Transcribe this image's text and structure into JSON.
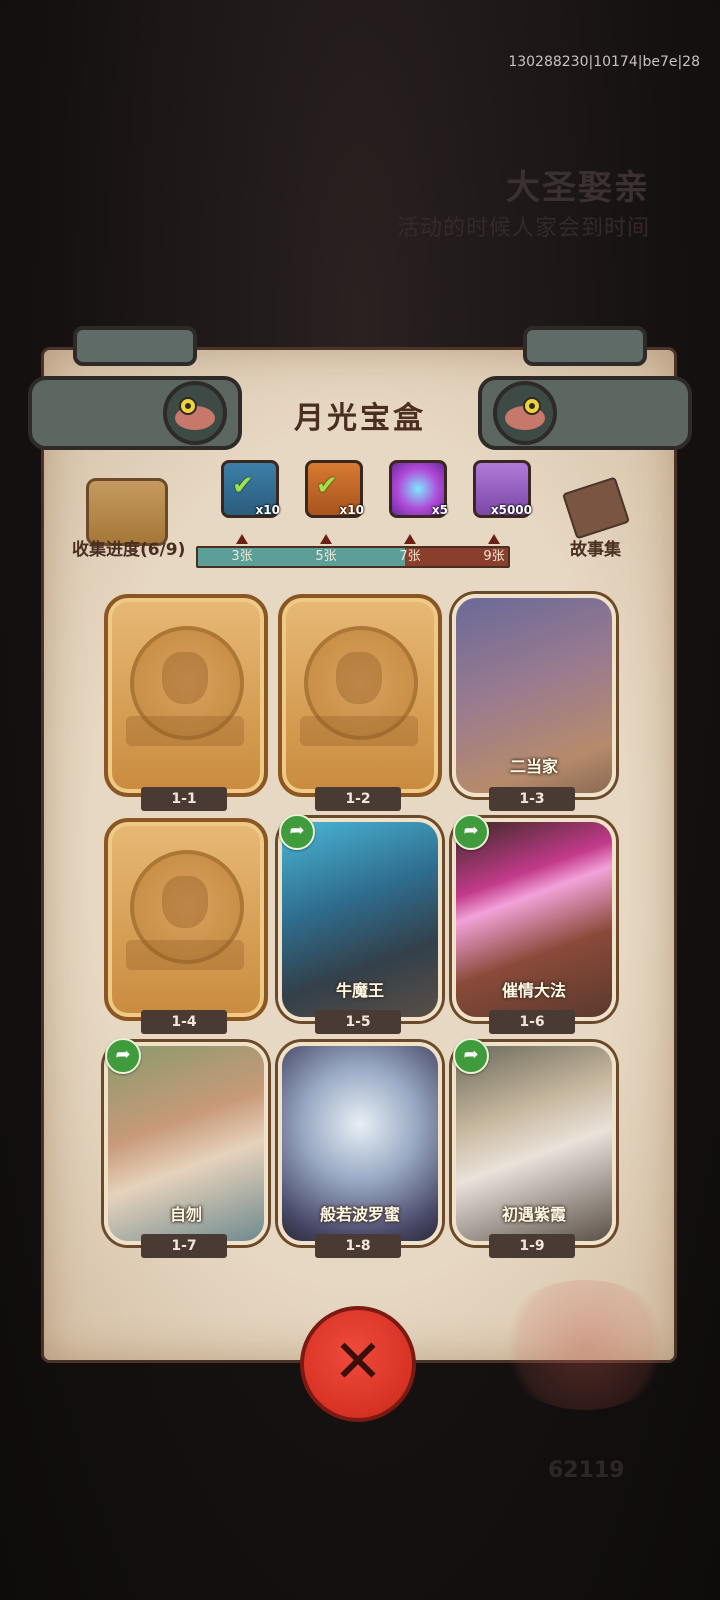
{
  "debug_id": "130288230|10174|be7e|28",
  "background": {
    "title": "大圣娶亲",
    "subtitle": "活动的时候人家会到时间",
    "coins": "62119"
  },
  "panel": {
    "title": "月光宝盒",
    "progress_label": "收集进度(6/9)",
    "progress_value": 6,
    "progress_max": 9,
    "story_label": "故事集"
  },
  "rewards": [
    {
      "icon": "chest-claimed-icon",
      "qty": "x10",
      "threshold": "3张",
      "claimed": true
    },
    {
      "icon": "ticket-claimed-icon",
      "qty": "x10",
      "threshold": "5张",
      "claimed": true
    },
    {
      "icon": "orb-icon",
      "qty": "x5",
      "threshold": "7张",
      "claimed": false
    },
    {
      "icon": "crystal-icon",
      "qty": "x5000",
      "threshold": "9张",
      "claimed": false
    }
  ],
  "cards": [
    {
      "id": "1-1",
      "name": "",
      "unlocked": false,
      "share": false
    },
    {
      "id": "1-2",
      "name": "",
      "unlocked": false,
      "share": false
    },
    {
      "id": "1-3",
      "name": "二当家",
      "unlocked": true,
      "share": false
    },
    {
      "id": "1-4",
      "name": "",
      "unlocked": false,
      "share": false
    },
    {
      "id": "1-5",
      "name": "牛魔王",
      "unlocked": true,
      "share": true
    },
    {
      "id": "1-6",
      "name": "催情大法",
      "unlocked": true,
      "share": true
    },
    {
      "id": "1-7",
      "name": "自刎",
      "unlocked": true,
      "share": true
    },
    {
      "id": "1-8",
      "name": "般若波罗蜜",
      "unlocked": true,
      "share": false
    },
    {
      "id": "1-9",
      "name": "初遇紫霞",
      "unlocked": true,
      "share": true
    }
  ],
  "colors": {
    "parchment": "#e7d8c3",
    "bar_filled": "#5c9e98",
    "bar_empty": "#8a3e2c",
    "close_red": "#d73224",
    "share_green": "#3f9b3c"
  }
}
